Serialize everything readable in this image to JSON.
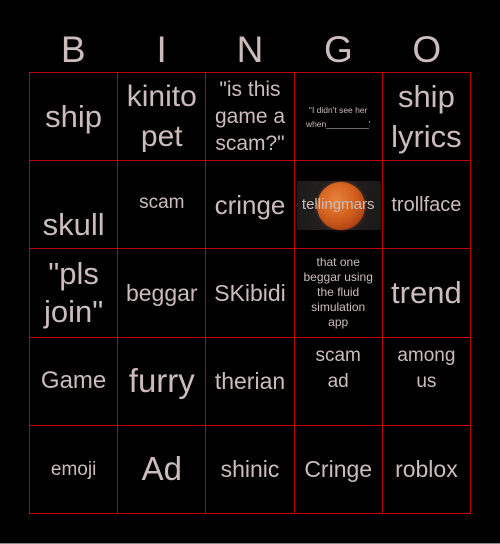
{
  "title_letters": [
    "B",
    "I",
    "N",
    "G",
    "O"
  ],
  "colors": {
    "background": "#000000",
    "grid_line": "#c00000",
    "text": "#cdbcbc"
  },
  "cells": [
    [
      {
        "text": "ship"
      },
      {
        "text": "kinito\npet"
      },
      {
        "text": "\"is this\ngame a\nscam?\""
      },
      {
        "text": "\"I didn't see her\nwhen_________'"
      },
      {
        "text": "ship\nlyrics"
      }
    ],
    [
      {
        "text": "skull"
      },
      {
        "text": "scam"
      },
      {
        "text": "cringe"
      },
      {
        "text": "tellingmars",
        "image": "mars-planet"
      },
      {
        "text": "trollface"
      }
    ],
    [
      {
        "text": "\"pls\njoin\""
      },
      {
        "text": "beggar"
      },
      {
        "text": "SKibidi"
      },
      {
        "text": "that one\nbeggar using\nthe fluid\nsimulation\napp"
      },
      {
        "text": "trend"
      }
    ],
    [
      {
        "text": "Game"
      },
      {
        "text": "furry"
      },
      {
        "text": "therian"
      },
      {
        "text": "scam\nad"
      },
      {
        "text": "among\nus"
      }
    ],
    [
      {
        "text": "emoji"
      },
      {
        "text": "Ad"
      },
      {
        "text": "shinic"
      },
      {
        "text": "Cringe"
      },
      {
        "text": "roblox"
      }
    ]
  ]
}
